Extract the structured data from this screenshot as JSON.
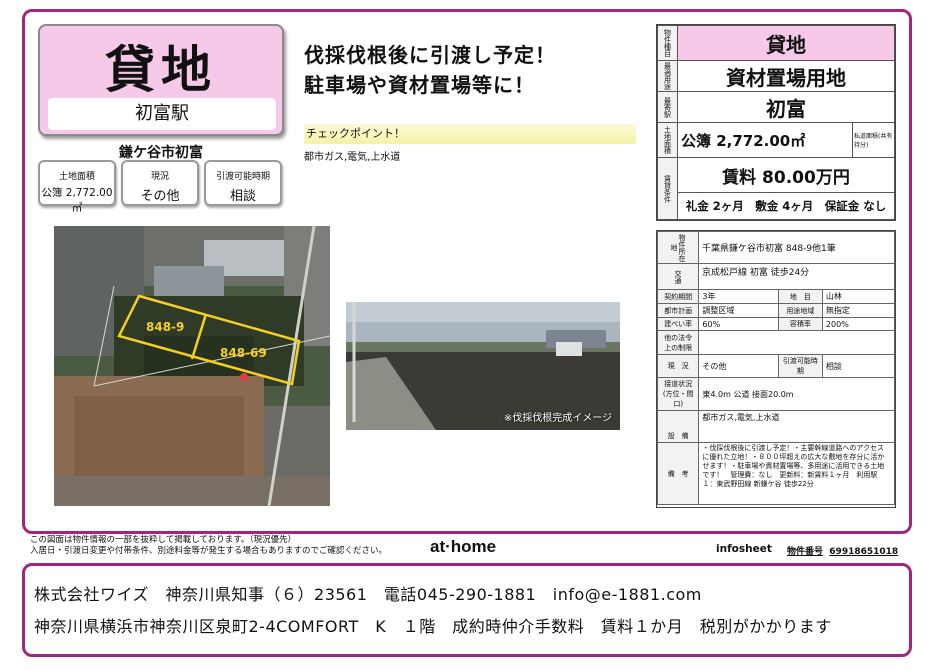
{
  "title": {
    "main": "貸地",
    "station": "初富駅",
    "location": "鎌ケ谷市初富"
  },
  "summary_cards": [
    {
      "label": "土地面積",
      "value": "公簿 2,772.00㎡"
    },
    {
      "label": "現況",
      "value": "その他"
    },
    {
      "label": "引渡可能時期",
      "value": "相談"
    }
  ],
  "headline": {
    "line1": "伐採伐根後に引渡し予定！",
    "line2": "駐車場や資材置場等に！"
  },
  "checkpoint": {
    "label": "チェックポイント！",
    "text": "都市ガス,電気,上水道"
  },
  "aerial": {
    "lot1": "848-9",
    "lot2": "848-69"
  },
  "photo": {
    "caption": "※伐採伐根完成イメージ"
  },
  "spec_top": {
    "l_type": "物件種目",
    "type": "貸地",
    "l_use": "最適用途",
    "use": "資材置場用地",
    "l_station": "最寄駅",
    "station": "初富",
    "l_area": "土地面積",
    "area": "公簿 2,772.00㎡",
    "area_note": "私道面積(共有持分)",
    "l_terms": "賃貸条件",
    "rent": "賃料 80.00万円",
    "deposits": "礼金 2ヶ月　敷金 4ヶ月　保証金 なし"
  },
  "spec_detail": {
    "l_address": "物件所在地",
    "address": "千葉県鎌ケ谷市初富 848-9他1筆",
    "l_transport": "交通",
    "transport": "京成松戸線 初富 徒歩24分",
    "rows": [
      {
        "k1": "契約期間",
        "v1": "3年",
        "k2": "地　目",
        "v2": "山林"
      },
      {
        "k1": "都市計画",
        "v1": "調整区域",
        "k2": "用途地域",
        "v2": "無指定"
      },
      {
        "k1": "建ぺい率",
        "v1": "60%",
        "k2": "容積率",
        "v2": "200%"
      }
    ],
    "l_other_law": "他の法令上の制限",
    "other_law": "",
    "l_status": "現　況",
    "status": "その他",
    "l_handover": "引渡可能時期",
    "handover": "相談",
    "l_road": "接道状況(方位・間口)",
    "road": "東4.0m 公道 接面20.0m",
    "l_facilities": "設　備",
    "facilities": "都市ガス,電気,上水道",
    "l_remarks": "備　考",
    "remarks": "・伐採伐根後に引渡し予定！・主要幹線道路へのアクセスに優れた立地！・８００坪超えの広大な敷地を存分に活かせます！・駐車場や資材置場等、多用途に活用できる土地です！　管理費：なし　更新料：新賃料１ヶ月　利用駅１：東武野田線 新鎌ケ谷 徒歩22分"
  },
  "footer": {
    "note1": "この図面は物件情報の一部を抜粋して掲載しております。（現況優先）",
    "note2": "入居日・引渡日変更や付帯条件、別途料金等が発生する場合もありますのでご確認ください。",
    "brand": "at·home",
    "infosheet": "infosheet",
    "bukken_label": "物件番号",
    "bukken_no": "69918651018"
  },
  "company": {
    "line1": "株式会社ワイズ　神奈川県知事（６）23561　電話045-290-1881　info@e-1881.com",
    "line2": "神奈川県横浜市神奈川区泉町2-4COMFORT　K　１階　成約時仲介手数料　賃料１か月　税別がかかります"
  },
  "colors": {
    "frame": "#a0267e",
    "pink": "#f7c9e9",
    "lot_outline": "#f5d020"
  }
}
